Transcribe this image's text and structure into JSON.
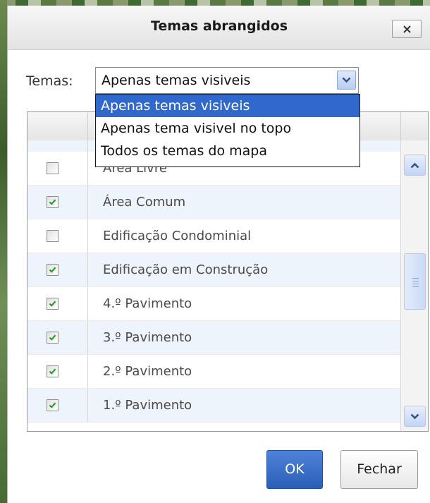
{
  "dialog": {
    "title": "Temas abrangidos",
    "close_symbol": "×"
  },
  "temas": {
    "label": "Temas:",
    "selected": "Apenas temas visiveis",
    "options": [
      "Apenas temas visiveis",
      "Apenas tema visivel no topo",
      "Todos os temas do mapa"
    ]
  },
  "grid": {
    "rows": [
      {
        "label": "Área Livre",
        "checked": false
      },
      {
        "label": "Área Comum",
        "checked": true
      },
      {
        "label": "Edificação Condominial",
        "checked": false
      },
      {
        "label": "Edificação em Construção",
        "checked": true
      },
      {
        "label": "4.º Pavimento",
        "checked": true
      },
      {
        "label": "3.º Pavimento",
        "checked": true
      },
      {
        "label": "2.º Pavimento",
        "checked": true
      },
      {
        "label": "1.º Pavimento",
        "checked": true
      }
    ]
  },
  "footer": {
    "ok_label": "OK",
    "close_label": "Fechar"
  },
  "colors": {
    "accent": "#3168cc",
    "check": "#2a9a2a",
    "ok_button": "#2b5fb7"
  },
  "icons": [
    "close-icon",
    "chevron-down-icon",
    "checkmark-icon",
    "arrow-up-icon",
    "arrow-down-icon"
  ]
}
